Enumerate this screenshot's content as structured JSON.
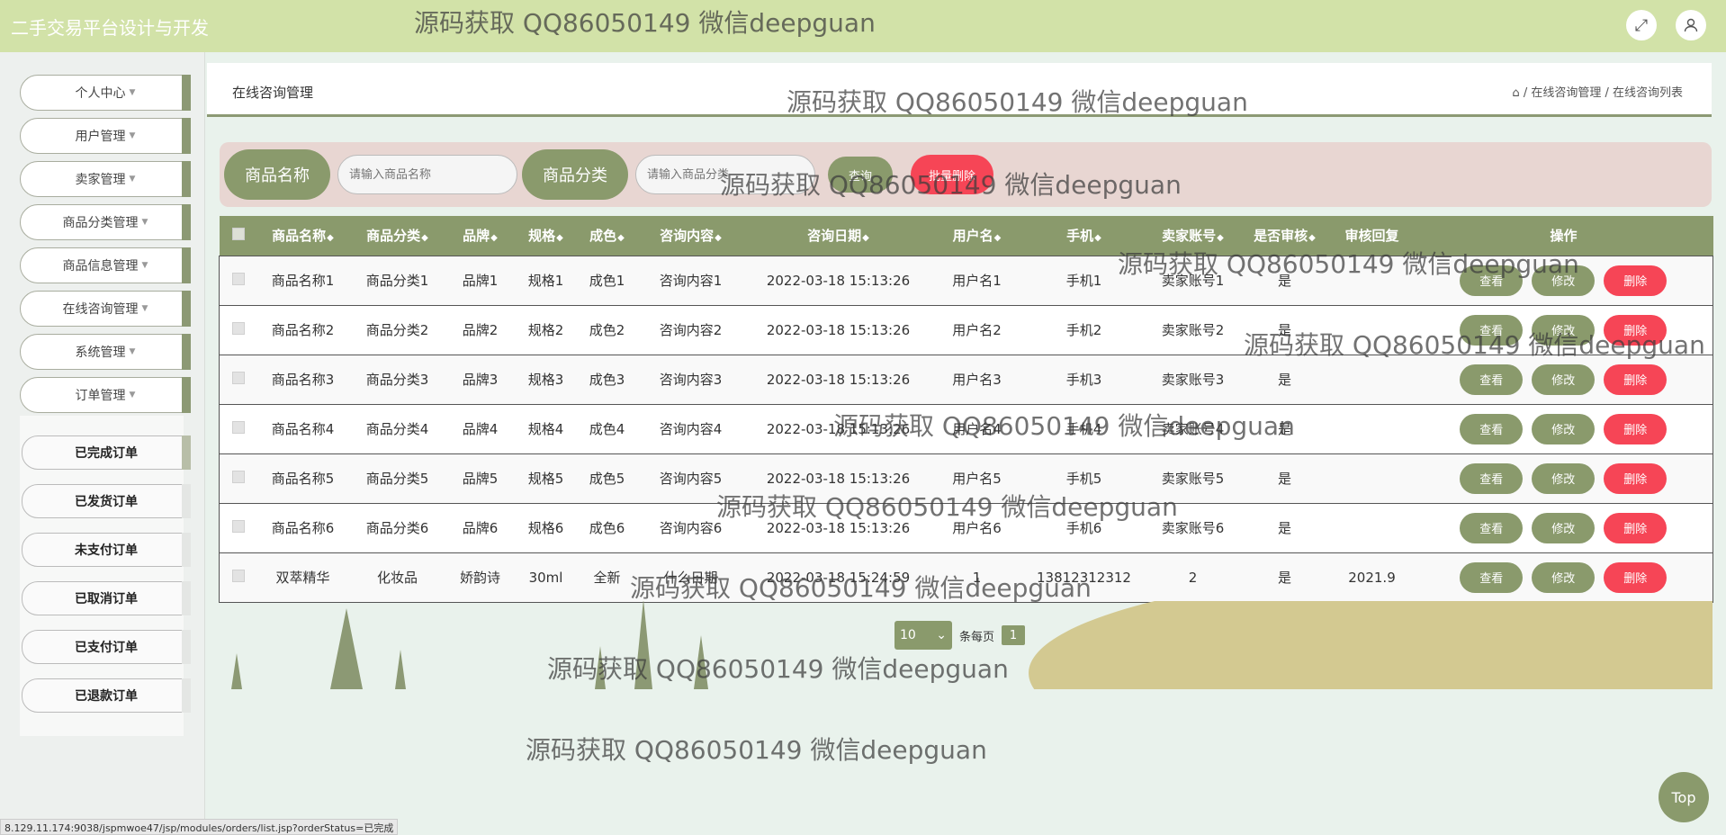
{
  "header": {
    "app_title": "二手交易平台设计与开发",
    "expand_icon": "expand-icon",
    "user_icon": "user-icon"
  },
  "sidebar": {
    "menu": [
      {
        "label": "个人中心"
      },
      {
        "label": "用户管理"
      },
      {
        "label": "卖家管理"
      },
      {
        "label": "商品分类管理"
      },
      {
        "label": "商品信息管理"
      },
      {
        "label": "在线咨询管理"
      },
      {
        "label": "系统管理"
      },
      {
        "label": "订单管理"
      }
    ],
    "submenu": [
      {
        "label": "已完成订单"
      },
      {
        "label": "已发货订单"
      },
      {
        "label": "未支付订单"
      },
      {
        "label": "已取消订单"
      },
      {
        "label": "已支付订单"
      },
      {
        "label": "已退款订单"
      }
    ]
  },
  "breadcrumb": {
    "page_title": "在线咨询管理",
    "trail": "/ 在线咨询管理 / 在线咨询列表"
  },
  "search": {
    "label_name": "商品名称",
    "placeholder_name": "请输入商品名称",
    "label_category": "商品分类",
    "placeholder_category": "请输入商品分类",
    "query_button": "查询",
    "batch_delete_button": "批量删除"
  },
  "table": {
    "headers": [
      "商品名称",
      "商品分类",
      "品牌",
      "规格",
      "成色",
      "咨询内容",
      "咨询日期",
      "用户名",
      "手机",
      "卖家账号",
      "是否审核",
      "审核回复",
      "操作"
    ],
    "rows": [
      [
        "商品名称1",
        "商品分类1",
        "品牌1",
        "规格1",
        "成色1",
        "咨询内容1",
        "2022-03-18 15:13:26",
        "用户名1",
        "手机1",
        "卖家账号1",
        "是",
        ""
      ],
      [
        "商品名称2",
        "商品分类2",
        "品牌2",
        "规格2",
        "成色2",
        "咨询内容2",
        "2022-03-18 15:13:26",
        "用户名2",
        "手机2",
        "卖家账号2",
        "是",
        ""
      ],
      [
        "商品名称3",
        "商品分类3",
        "品牌3",
        "规格3",
        "成色3",
        "咨询内容3",
        "2022-03-18 15:13:26",
        "用户名3",
        "手机3",
        "卖家账号3",
        "是",
        ""
      ],
      [
        "商品名称4",
        "商品分类4",
        "品牌4",
        "规格4",
        "成色4",
        "咨询内容4",
        "2022-03-18 15:13:26",
        "用户名4",
        "手机4",
        "卖家账号4",
        "是",
        ""
      ],
      [
        "商品名称5",
        "商品分类5",
        "品牌5",
        "规格5",
        "成色5",
        "咨询内容5",
        "2022-03-18 15:13:26",
        "用户名5",
        "手机5",
        "卖家账号5",
        "是",
        ""
      ],
      [
        "商品名称6",
        "商品分类6",
        "品牌6",
        "规格6",
        "成色6",
        "咨询内容6",
        "2022-03-18 15:13:26",
        "用户名6",
        "手机6",
        "卖家账号6",
        "是",
        ""
      ],
      [
        "双萃精华",
        "化妆品",
        "娇韵诗",
        "30ml",
        "全新",
        "什么日期",
        "2022-03-18 15:24:59",
        "1",
        "13812312312",
        "2",
        "是",
        "2021.9"
      ]
    ],
    "actions": {
      "view": "查看",
      "edit": "修改",
      "delete": "删除"
    }
  },
  "pagination": {
    "page_size": "10",
    "per_page_text": "条每页",
    "current_page": "1"
  },
  "top_button": "Top",
  "status_url": "8.129.11.174:9038/jspmwoe47/jsp/modules/orders/list.jsp?orderStatus=已完成",
  "watermark": "源码获取 QQ86050149 微信deepguan",
  "colors": {
    "accent": "#8a9a6c",
    "header_bg": "#d2e2a8",
    "danger": "#f64556",
    "search_bg": "#e8d6d2"
  }
}
